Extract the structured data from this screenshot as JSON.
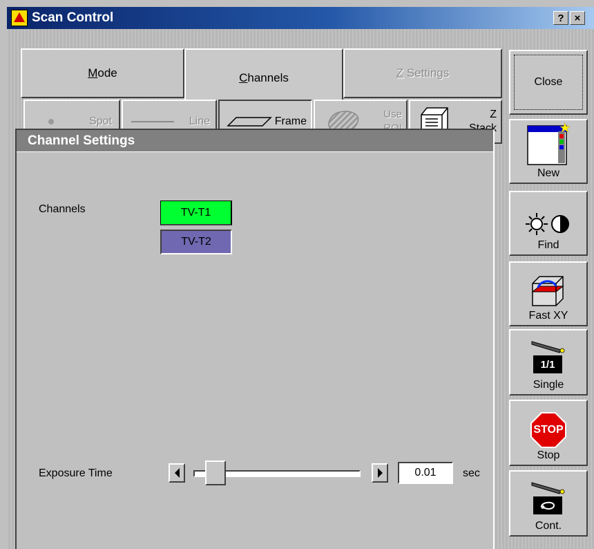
{
  "window": {
    "title": "Scan Control",
    "help_label": "?",
    "close_label": "×"
  },
  "mode_tabs": [
    {
      "label": "Mode",
      "underline": "M",
      "rest": "ode",
      "state": "normal"
    },
    {
      "label": "Channels",
      "underline": "C",
      "rest": "hannels",
      "state": "selected"
    },
    {
      "label": "Z Settings",
      "underline": "Z",
      "rest": " Settings",
      "state": "disabled"
    }
  ],
  "scan_modes": [
    {
      "label": "Spot",
      "icon": "spot-icon",
      "enabled": false
    },
    {
      "label": "Line",
      "icon": "line-icon",
      "enabled": false
    },
    {
      "label": "Frame",
      "icon": "frame-icon",
      "enabled": true,
      "selected": true
    },
    {
      "label_line1": "Use",
      "label_line2": "ROI",
      "icon": "roi-icon",
      "enabled": false
    },
    {
      "label_line1": "Z",
      "label_line2": "Stack",
      "icon": "z-stack-icon",
      "enabled": true
    }
  ],
  "panel": {
    "title": "Channel Settings",
    "channels_label": "Channels",
    "channels": [
      {
        "label": "TV-T1",
        "color": "#00ff30"
      },
      {
        "label": "TV-T2",
        "color": "#7068b0"
      }
    ],
    "exposure": {
      "label": "Exposure Time",
      "value": "0.01",
      "unit": "sec",
      "slider_fraction": 0.08
    }
  },
  "tools": {
    "close": "Close",
    "new": "New",
    "find": "Find",
    "fast_xy": "Fast XY",
    "single": "Single",
    "single_ratio": "1/1",
    "stop": "Stop",
    "stop_sign": "STOP",
    "cont": "Cont."
  },
  "colors": {
    "title_bar": "#0a246a",
    "channel_1": "#00ff30",
    "channel_2": "#7068b0",
    "stop_red": "#e00000"
  }
}
